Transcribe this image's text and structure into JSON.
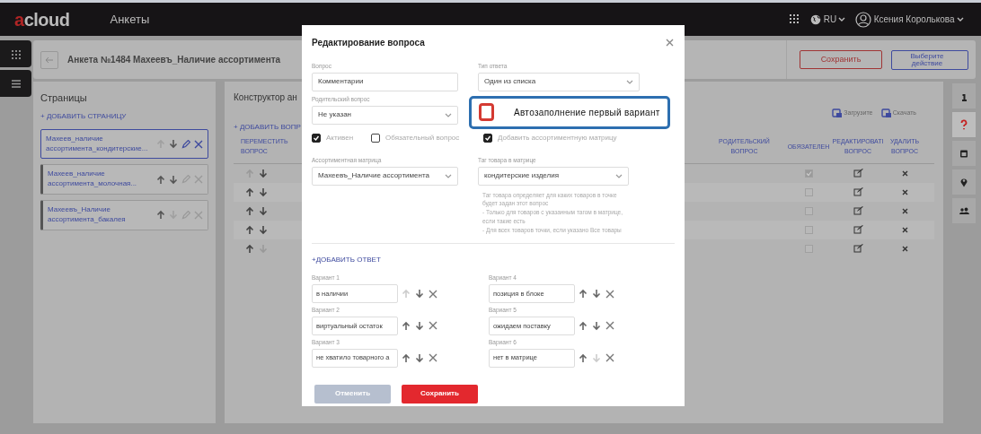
{
  "app": {
    "logo": "acloud",
    "section": "Анкеты",
    "language": "RU",
    "user": "Ксения Королькова"
  },
  "page": {
    "title": "Анкета №1484 Махеевъ_Наличие ассортимента",
    "buttons": [
      {
        "label": "Сохранить",
        "kind": "danger"
      },
      {
        "label": "Выберите действие",
        "kind": "primary"
      }
    ]
  },
  "side_tools": [
    {
      "kind": "info",
      "selected": false
    },
    {
      "kind": "question",
      "selected": true
    },
    {
      "kind": "calendar",
      "selected": false
    },
    {
      "kind": "pin",
      "selected": false
    },
    {
      "kind": "users",
      "selected": false
    }
  ],
  "pages_panel": {
    "title": "Страницы",
    "add": "+ ДОБАВИТЬ СТРАНИЦУ",
    "items": [
      {
        "label": "Махеев_наличие ассортимента_кондитерские...",
        "selected": true,
        "can_up": false,
        "can_down": true
      },
      {
        "label": "Махеев_наличие ассортимента_молочная...",
        "selected": false,
        "can_up": true,
        "can_down": true
      },
      {
        "label": "Махеевъ_Наличие ассортимента_бакалея",
        "selected": false,
        "can_up": true,
        "can_down": false
      }
    ]
  },
  "constructor": {
    "title": "Конструктор ан",
    "add": "+ ДОБАВИТЬ ВОПР",
    "actions": [
      "Загрузите",
      "Скачать"
    ],
    "columns": [
      "ПЕРЕМЕСТИТЬ ВОПРОС",
      "РОДИТЕЛЬСКИЙ ВОПРОС",
      "ОБЯЗАТЕЛЕН",
      "РЕДАКТИРОВАТІ ВОПРОС",
      "УДАЛИТЬ ВОПРОС"
    ],
    "rows": [
      {
        "can_up": false,
        "can_down": true,
        "required": true
      },
      {
        "can_up": true,
        "can_down": true,
        "required": false
      },
      {
        "can_up": true,
        "can_down": true,
        "required": false
      },
      {
        "can_up": true,
        "can_down": true,
        "required": false
      },
      {
        "can_up": true,
        "can_down": false,
        "required": false
      }
    ]
  },
  "modal": {
    "title": "Редактирование вопроса",
    "question": {
      "label": "Вопрос",
      "value": "Комментарии"
    },
    "answer_type": {
      "label": "Тип ответа",
      "value": "Один из списка"
    },
    "parent": {
      "label": "Родительский вопрос",
      "value": "Не указан"
    },
    "autofill": {
      "label": "Автозаполнение первый вариант",
      "checked": false
    },
    "checkboxes": [
      {
        "label": "Активен",
        "checked": true
      },
      {
        "label": "Обязательный вопрос",
        "checked": false
      }
    ],
    "matrix_toggle": {
      "label": "Добавить ассортиментную матрицу",
      "checked": true
    },
    "matrix": {
      "label": "Ассортиментная матрица",
      "value": "Махеевъ_Наличие ассортимента"
    },
    "tag": {
      "label": "Таг товара в матрице",
      "value": "кондитерские изделия"
    },
    "hint": [
      "Таг товара определяет для каких товаров в точке будет задан этот вопрос",
      "- Только для товаров с указанным тагом в матрице, если такие есть",
      "- Для всех товаров точки, если указано Все товары"
    ],
    "add_answer": "+ДОБАВИТЬ ОТВЕТ",
    "answers": [
      {
        "label": "Вариант 1",
        "value": "в наличии",
        "can_up": false,
        "can_down": true
      },
      {
        "label": "Вариант 2",
        "value": "виртуальный остаток",
        "can_up": true,
        "can_down": true
      },
      {
        "label": "Вариант 3",
        "value": "не хватило товарного а",
        "can_up": true,
        "can_down": true
      },
      {
        "label": "Вариант 4",
        "value": "позиция в блоке",
        "can_up": true,
        "can_down": true
      },
      {
        "label": "Вариант 5",
        "value": "ожидаем поставку",
        "can_up": true,
        "can_down": true
      },
      {
        "label": "Вариант 6",
        "value": "нет в матрице",
        "can_up": true,
        "can_down": false
      }
    ],
    "buttons": [
      {
        "label": "Отменить",
        "kind": "secondary"
      },
      {
        "label": "Сохранить",
        "kind": "danger"
      }
    ]
  }
}
